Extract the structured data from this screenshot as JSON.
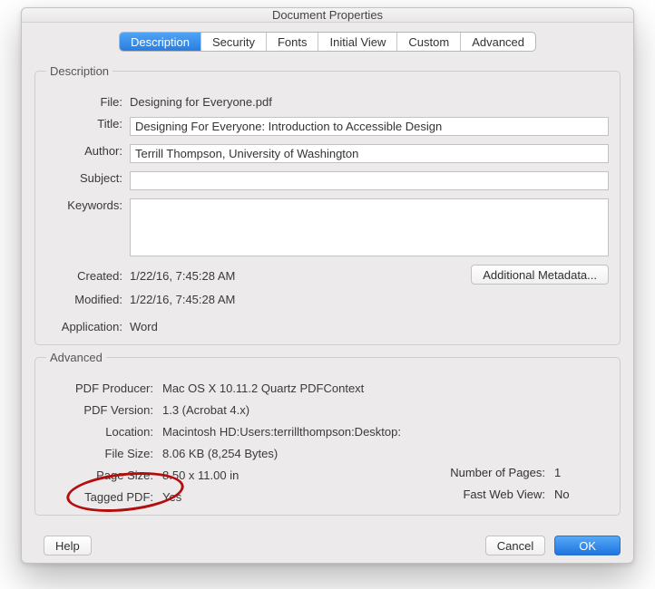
{
  "window": {
    "title": "Document Properties"
  },
  "tabs": {
    "description": "Description",
    "security": "Security",
    "fonts": "Fonts",
    "initial_view": "Initial View",
    "custom": "Custom",
    "advanced": "Advanced"
  },
  "description_group": {
    "legend": "Description",
    "file_label": "File:",
    "file_value": "Designing for Everyone.pdf",
    "title_label": "Title:",
    "title_value": "Designing For Everyone: Introduction to Accessible Design",
    "author_label": "Author:",
    "author_value": "Terrill Thompson, University of Washington",
    "subject_label": "Subject:",
    "subject_value": "",
    "keywords_label": "Keywords:",
    "keywords_value": "",
    "created_label": "Created:",
    "created_value": "1/22/16, 7:45:28 AM",
    "modified_label": "Modified:",
    "modified_value": "1/22/16, 7:45:28 AM",
    "application_label": "Application:",
    "application_value": "Word",
    "additional_metadata": "Additional Metadata..."
  },
  "advanced_group": {
    "legend": "Advanced",
    "pdf_producer_label": "PDF Producer:",
    "pdf_producer_value": "Mac OS X 10.11.2 Quartz PDFContext",
    "pdf_version_label": "PDF Version:",
    "pdf_version_value": "1.3 (Acrobat 4.x)",
    "location_label": "Location:",
    "location_value": "Macintosh HD:Users:terrillthompson:Desktop:",
    "file_size_label": "File Size:",
    "file_size_value": "8.06 KB (8,254 Bytes)",
    "page_size_label": "Page Size:",
    "page_size_value": "8.50 x 11.00 in",
    "num_pages_label": "Number of Pages:",
    "num_pages_value": "1",
    "tagged_pdf_label": "Tagged PDF:",
    "tagged_pdf_value": "Yes",
    "fast_web_label": "Fast Web View:",
    "fast_web_value": "No"
  },
  "buttons": {
    "help": "Help",
    "cancel": "Cancel",
    "ok": "OK"
  }
}
